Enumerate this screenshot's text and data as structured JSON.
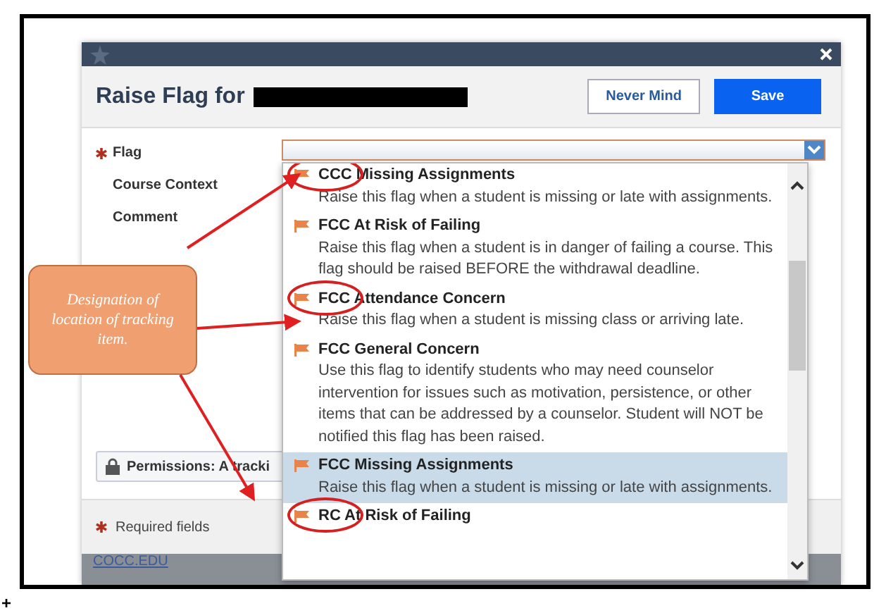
{
  "dialog": {
    "title": "Raise Flag for",
    "buttons": [
      {
        "label": "Never Mind",
        "kind": "secondary"
      },
      {
        "label": "Save",
        "kind": "primary"
      }
    ],
    "fields": [
      {
        "label": "Flag",
        "required": true
      },
      {
        "label": "Course Context",
        "required": false
      },
      {
        "label": "Comment",
        "required": false
      }
    ],
    "permissions": "Permissions: A tracki",
    "required_note": "Required fields",
    "footer_link": "COCC.EDU"
  },
  "dropdown": {
    "options": [
      {
        "title": "CCC Missing Assignments",
        "description": "Raise this flag when a student is missing or late with assignments.",
        "selected": false,
        "circled": true
      },
      {
        "title": "FCC At Risk of Failing",
        "description": "Raise this flag when a student is in danger of failing a course. This flag should be raised BEFORE the withdrawal deadline.",
        "selected": false,
        "circled": false
      },
      {
        "title": "FCC Attendance Concern",
        "description": "Raise this flag when a student is missing class or arriving late.",
        "selected": false,
        "circled": true
      },
      {
        "title": "FCC General Concern",
        "description": "Use this flag to identify students who may need counselor intervention for issues such as motivation, persistence, or other items that can be addressed by a counselor. Student will NOT be notified this flag has been raised.",
        "selected": false,
        "circled": false
      },
      {
        "title": "FCC Missing Assignments",
        "description": "Raise this flag when a student is missing or late with assignments.",
        "selected": true,
        "circled": false
      },
      {
        "title": "RC At Risk of Failing",
        "selected": false,
        "circled": true
      }
    ]
  },
  "callout": {
    "text": "Designation of location of tracking item."
  },
  "corner_mark": "+"
}
